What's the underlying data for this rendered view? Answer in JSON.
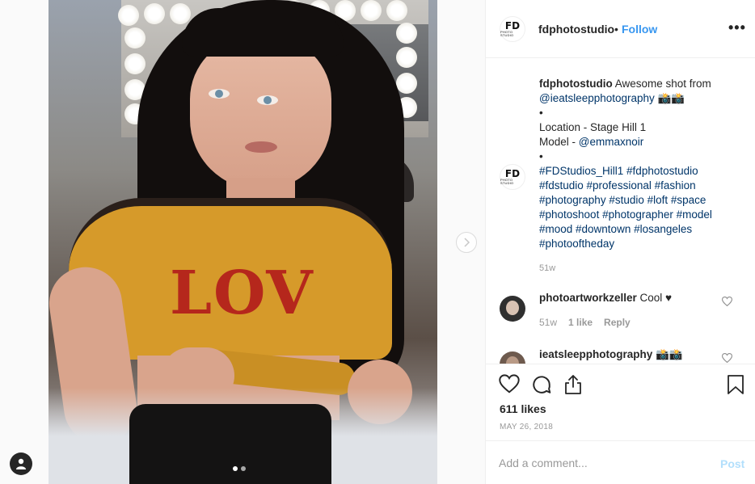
{
  "post": {
    "username": "fdphotostudio",
    "separator": "•",
    "follow_label": "Follow",
    "more_label": "•••",
    "logo_text": "FD",
    "logo_sub": "PHOTO STUDIO"
  },
  "photo": {
    "shirt_text": "LOV",
    "carousel_total": 2,
    "carousel_index": 1
  },
  "caption": {
    "username": "fdphotostudio",
    "text": "Awesome shot from",
    "mention": "@ieatsleepphotography",
    "emoji": "📸📸",
    "bullet1": "•",
    "location": "Location - Stage Hill 1",
    "model_label": "Model - ",
    "model_mention": "@emmaxnoir",
    "bullet2": "•",
    "hashtags_line1": "#FDStudios_Hill1 #fdphotostudio",
    "hashtags_line2": "#fdstudio #professional #fashion",
    "hashtags_line3": "#photography #studio #loft #space",
    "hashtags_line4": "#photoshoot #photographer #model",
    "hashtags_line5": "#mood #downtown #losangeles",
    "hashtags_line6": "#photooftheday",
    "time": "51w"
  },
  "comments": [
    {
      "username": "photoartworkzeller",
      "text": "Cool ♥",
      "time": "51w",
      "likes": "1 like",
      "reply": "Reply"
    },
    {
      "username": "ieatsleepphotography",
      "text": "📸📸"
    }
  ],
  "stats": {
    "likes": "611 likes",
    "date": "MAY 26, 2018"
  },
  "comment_box": {
    "placeholder": "Add a comment...",
    "post_label": "Post"
  },
  "colors": {
    "link": "#003569",
    "follow": "#3897f0",
    "post_disabled": "#b2dffc"
  }
}
